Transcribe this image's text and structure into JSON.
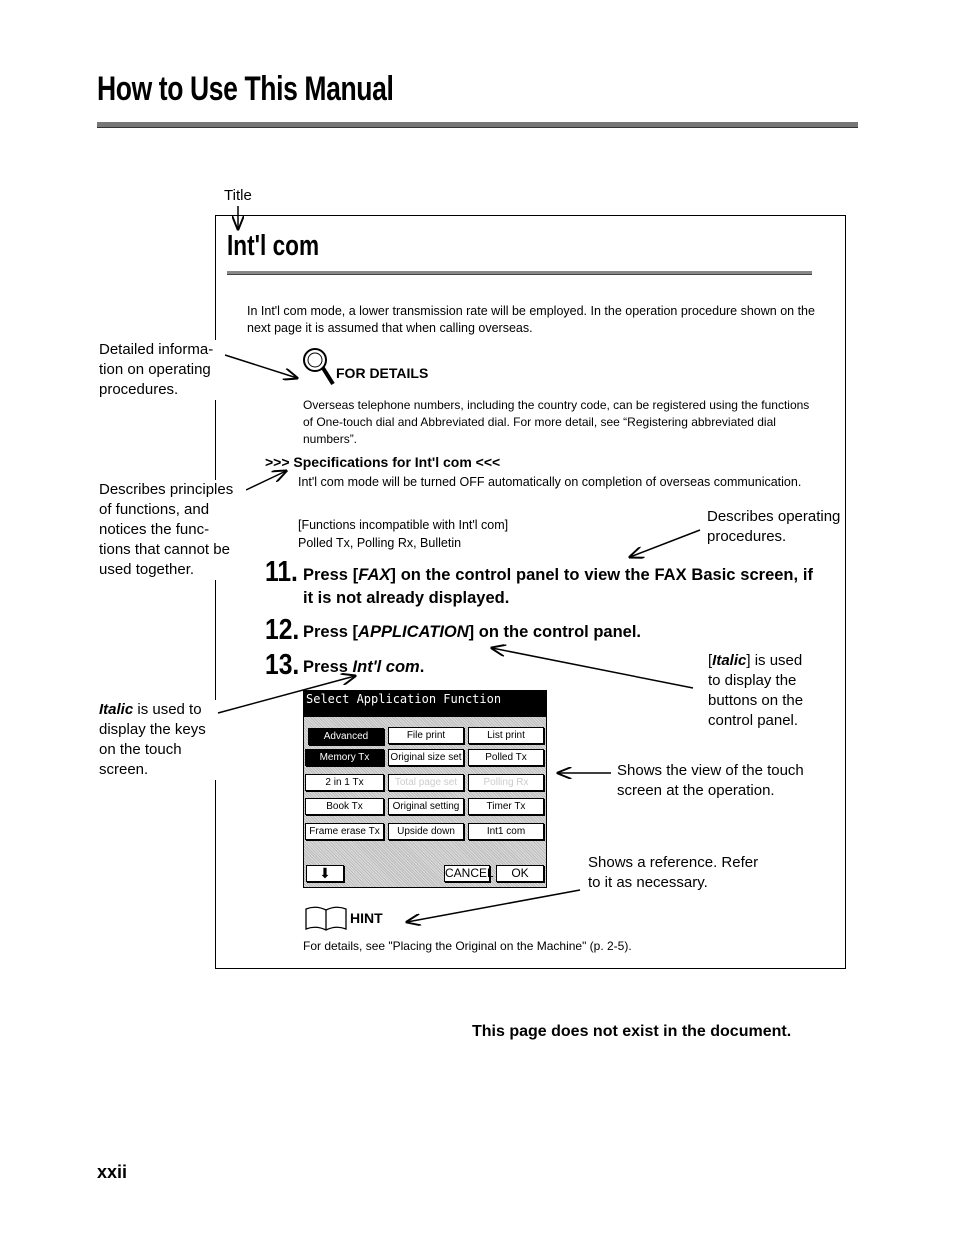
{
  "header": {
    "title": "How to Use This Manual"
  },
  "callouts": {
    "title": "Title",
    "detailed": "Detailed informa-\ntion on operating\nprocedures.",
    "principles": "Describes principles\nof functions, and\nnotices the func-\ntions that cannot be\nused together.",
    "operating": "Describes operating\nprocedures.",
    "italic_keys_bold": "Italic",
    "italic_keys": " is used to\ndisplay the keys\non the touch\nscreen.",
    "italic_buttons_bold": "Italic",
    "italic_buttons": "] is used\nto display the\nbuttons on the\ncontrol panel.",
    "touch_view": "Shows the view of the touch\nscreen at the operation.",
    "reference": "Shows a reference. Refer\nto it as necessary."
  },
  "sample": {
    "title": "Int'l com",
    "intro": "In Int'l com mode, a lower transmission rate will be employed.  In the operation procedure shown on the next page it is assumed that when calling overseas.",
    "for_details_label": "FOR DETAILS",
    "for_details_text": "Overseas telephone numbers, including the country code, can be registered using the functions of One-touch dial and Abbreviated dial.  For more detail, see “Registering abbreviated dial numbers”.",
    "spec_heading": ">>> Specifications for Int'l com <<<",
    "spec_text": "Int'l com mode will be turned OFF automatically on completion of overseas communication.",
    "incompatible_heading": "[Functions incompatible with Int'l com]",
    "incompatible_list": "Polled Tx, Polling Rx, Bulletin",
    "steps": [
      {
        "num": "11.",
        "pre": "Press [",
        "key": "FAX",
        "post": "] on the control panel to view the FAX Basic screen, if it is not already displayed."
      },
      {
        "num": "12.",
        "pre": "Press [",
        "key": "APPLICATION",
        "post": "] on the control panel."
      },
      {
        "num": "13.",
        "pre": "Press ",
        "key": "Int'l com",
        "post": "."
      }
    ],
    "screen": {
      "title": "Select Application Function",
      "tabs": [
        "Advanced",
        "File print",
        "List print"
      ],
      "buttons": [
        "Memory Tx",
        "Original size set",
        "Polled Tx",
        "2 in 1 Tx",
        "Total page set",
        "Polling Rx",
        "Book Tx",
        "Original setting",
        "Timer Tx",
        "Frame erase Tx",
        "Upside down",
        "Int1 com"
      ],
      "cancel": "CANCEL",
      "ok": "OK"
    },
    "hint_label": "HINT",
    "hint_text": "For details, see \"Placing the Original on the Machine\" (p. 2-5)."
  },
  "notice": "This page does not exist in the document.",
  "page_number": "xxii"
}
